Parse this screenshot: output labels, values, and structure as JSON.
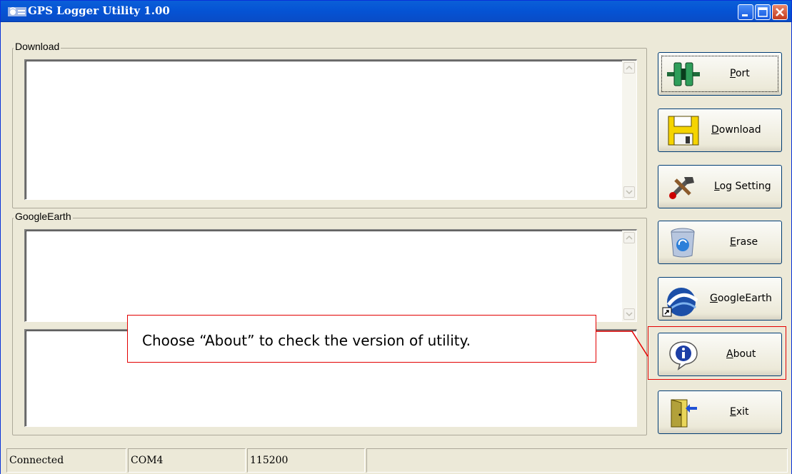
{
  "window": {
    "title": "GPS Logger Utility 1.00"
  },
  "groups": {
    "download_label": "Download",
    "googleearth_label": "GoogleEarth"
  },
  "buttons": [
    {
      "id": "port",
      "label": "Port",
      "icon": "port-connector-icon"
    },
    {
      "id": "download",
      "label": "Download",
      "icon": "floppy-disk-icon"
    },
    {
      "id": "log_setting",
      "label": "Log Setting",
      "icon": "tools-icon"
    },
    {
      "id": "erase",
      "label": "Erase",
      "icon": "recycle-bin-icon"
    },
    {
      "id": "googleearth",
      "label": "GoogleEarth",
      "icon": "google-earth-icon"
    },
    {
      "id": "about",
      "label": "About",
      "icon": "info-icon"
    },
    {
      "id": "exit",
      "label": "Exit",
      "icon": "exit-door-icon"
    }
  ],
  "callout": {
    "text": "Choose “About” to check the version of utility."
  },
  "status": {
    "connection": "Connected",
    "port": "COM4",
    "baud": "115200",
    "extra": ""
  },
  "colors": {
    "titlebar": "#0553d4",
    "callout_border": "#e30000",
    "window_bg": "#ece9d8"
  }
}
